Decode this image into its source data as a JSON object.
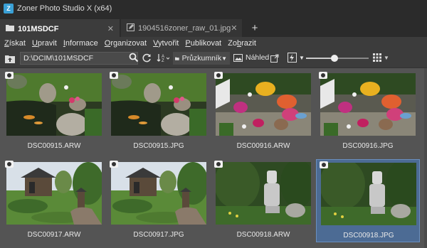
{
  "window": {
    "title": "Zoner Photo Studio X (x64)",
    "app_icon": "Z"
  },
  "tabs": [
    {
      "label": "101MSDCF",
      "active": true,
      "icon": "folder-icon"
    },
    {
      "label": "1904516zoner_raw_01.jpg",
      "active": false,
      "icon": "edit-icon"
    }
  ],
  "tab_add": "+",
  "menu": [
    {
      "label": "Získat",
      "key": "Z",
      "rest": "ískat"
    },
    {
      "label": "Upravit",
      "key": "U",
      "rest": "pravit"
    },
    {
      "label": "Informace",
      "key": "I",
      "rest": "nformace"
    },
    {
      "label": "Organizovat",
      "key": "O",
      "rest": "rganizovat"
    },
    {
      "label": "Vytvořit",
      "key": "V",
      "rest": "ytvořit"
    },
    {
      "label": "Publikovat",
      "key": "P",
      "rest": "ublikovat"
    },
    {
      "label": "Zobrazit",
      "key": "b",
      "pre": "Zo",
      "rest": "razit"
    }
  ],
  "toolbar": {
    "path": "D:\\DCIM\\101MSDCF",
    "view_mode": "Průzkumník",
    "preview_label": "Náhled",
    "zoom_level": 0.45
  },
  "thumbnails": [
    {
      "filename": "DSC00915.ARW",
      "scene": "pond",
      "selected": false
    },
    {
      "filename": "DSC00915.JPG",
      "scene": "pond",
      "selected": false
    },
    {
      "filename": "DSC00916.ARW",
      "scene": "flowers",
      "selected": false
    },
    {
      "filename": "DSC00916.JPG",
      "scene": "flowers",
      "selected": false
    },
    {
      "filename": "DSC00917.ARW",
      "scene": "gazebo",
      "selected": false
    },
    {
      "filename": "DSC00917.JPG",
      "scene": "gazebo",
      "selected": false
    },
    {
      "filename": "DSC00918.ARW",
      "scene": "statue",
      "selected": false
    },
    {
      "filename": "DSC00918.JPG",
      "scene": "statue",
      "selected": true
    }
  ],
  "colors": {
    "accent": "#4c6b94",
    "background": "#3c3c3c",
    "gallery": "#545454"
  }
}
